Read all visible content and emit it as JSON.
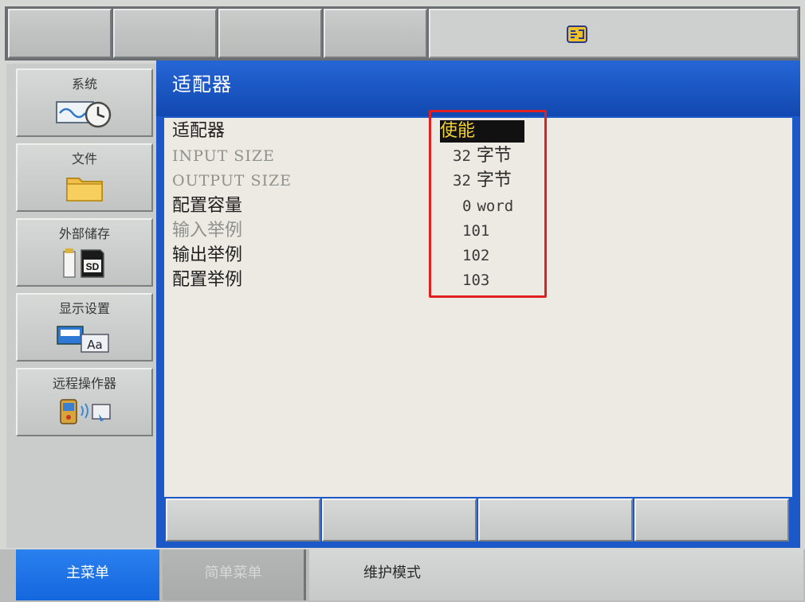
{
  "colors": {
    "title_bar": "#1d58c8",
    "main_menu_tab": "#1a6fe6",
    "cursor_bg": "#111111",
    "cursor_text": "#f2d235",
    "annotation": "#e0201e"
  },
  "status_bar": {
    "icon": "teach-pendant-status-icon"
  },
  "sidebar": {
    "items": [
      {
        "label": "系统",
        "icon": "waveform-clock-icon"
      },
      {
        "label": "文件",
        "icon": "folder-icon"
      },
      {
        "label": "外部储存",
        "icon": "sd-card-icon"
      },
      {
        "label": "显示设置",
        "icon": "display-font-icon"
      },
      {
        "label": "远程操作器",
        "icon": "remote-pendant-icon"
      }
    ]
  },
  "main": {
    "title": "适配器",
    "rows": [
      {
        "label": "适配器",
        "value": "使能",
        "state": "active"
      },
      {
        "label": "INPUT SIZE",
        "num": "32",
        "unit": "字节",
        "state": "dim"
      },
      {
        "label": "OUTPUT SIZE",
        "num": "32",
        "unit": "字节",
        "state": "dim"
      },
      {
        "label": "配置容量",
        "num": "0",
        "unit": "word",
        "state": "active"
      },
      {
        "label": "输入举例",
        "num": "101",
        "unit": "",
        "state": "dim"
      },
      {
        "label": "输出举例",
        "num": "102",
        "unit": "",
        "state": "active"
      },
      {
        "label": "配置举例",
        "num": "103",
        "unit": "",
        "state": "active"
      }
    ]
  },
  "bottom_menu": {
    "main_menu": "主菜单",
    "simple_menu": "简单菜单",
    "maintenance_mode": "维护模式"
  }
}
